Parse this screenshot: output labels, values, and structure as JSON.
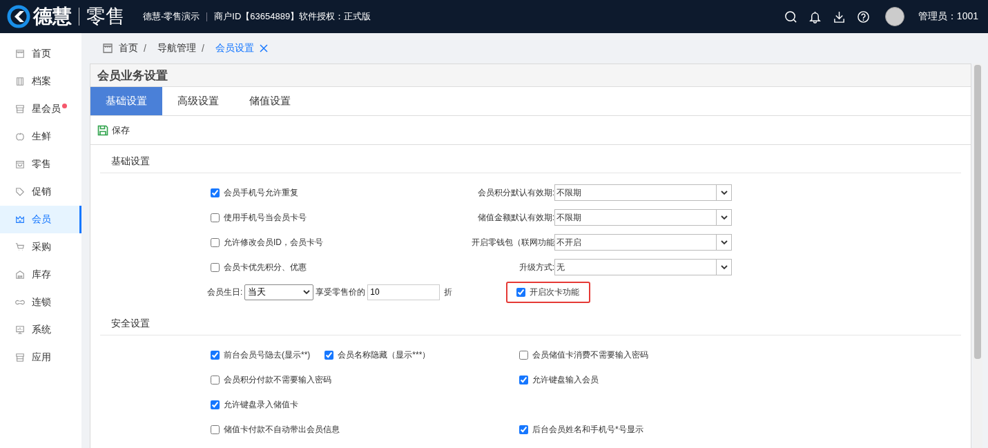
{
  "header": {
    "brand_name": "德慧",
    "brand_product": "零售",
    "store": "德慧-零售演示",
    "license": "商户ID【63654889】软件授权：正式版",
    "user": "管理员：1001"
  },
  "sidebar": {
    "items": [
      {
        "label": "首页",
        "selected": false,
        "badge": false
      },
      {
        "label": "档案",
        "selected": false,
        "badge": false
      },
      {
        "label": "星会员",
        "selected": false,
        "badge": true
      },
      {
        "label": "生鲜",
        "selected": false,
        "badge": false
      },
      {
        "label": "零售",
        "selected": false,
        "badge": false
      },
      {
        "label": "促销",
        "selected": false,
        "badge": false
      },
      {
        "label": "会员",
        "selected": true,
        "badge": false
      },
      {
        "label": "采购",
        "selected": false,
        "badge": false
      },
      {
        "label": "库存",
        "selected": false,
        "badge": false
      },
      {
        "label": "连锁",
        "selected": false,
        "badge": false
      },
      {
        "label": "系统",
        "selected": false,
        "badge": false
      },
      {
        "label": "应用",
        "selected": false,
        "badge": false
      }
    ]
  },
  "breadcrumb": {
    "separator": "/",
    "items": [
      {
        "label": "首页",
        "current": false
      },
      {
        "label": "导航管理",
        "current": false
      },
      {
        "label": "会员设置",
        "current": true
      }
    ]
  },
  "panel": {
    "title": "会员业务设置",
    "tabs": [
      {
        "label": "基础设置",
        "selected": true
      },
      {
        "label": "高级设置",
        "selected": false
      },
      {
        "label": "储值设置",
        "selected": false
      }
    ],
    "save_button": "保存",
    "basic": {
      "title": "基础设置",
      "left": [
        {
          "kind": "checkbox",
          "label": "会员手机号允许重复",
          "checked": true
        },
        {
          "kind": "checkbox",
          "label": "使用手机号当会员卡号",
          "checked": false
        },
        {
          "kind": "checkbox",
          "label": "允许修改会员ID，会员卡号",
          "checked": false
        },
        {
          "kind": "checkbox",
          "label": "会员卡优先积分、优惠",
          "checked": false
        },
        {
          "kind": "birthday",
          "label": "会员生日:",
          "select_value": "当天",
          "mid_label": "享受零售价的",
          "input_value": "10",
          "unit": "折"
        }
      ],
      "right": [
        {
          "kind": "select",
          "label": "会员积分默认有效期:",
          "value": "不限期"
        },
        {
          "kind": "select",
          "label": "储值金额默认有效期:",
          "value": "不限期"
        },
        {
          "kind": "select",
          "label": "开启零钱包（联网功能",
          "value": "不开启"
        },
        {
          "kind": "select",
          "label": "升级方式:",
          "value": "无"
        },
        {
          "kind": "checkbox",
          "label": "开启次卡功能",
          "checked": true,
          "highlighted": true
        }
      ]
    },
    "security": {
      "title": "安全设置",
      "rows": [
        {
          "left": [
            {
              "label": "前台会员号隐去(显示**)",
              "checked": true
            },
            {
              "label": "会员名称隐藏（显示***）",
              "checked": true
            }
          ],
          "right": [
            {
              "label": "会员储值卡消费不需要输入密码",
              "checked": false
            }
          ]
        },
        {
          "left": [
            {
              "label": "会员积分付款不需要输入密码",
              "checked": false
            }
          ],
          "right": [
            {
              "label": "允许键盘输入会员",
              "checked": true
            }
          ]
        },
        {
          "left": [
            {
              "label": "允许键盘录入储值卡",
              "checked": true
            }
          ],
          "right": []
        },
        {
          "left": [
            {
              "label": "储值卡付款不自动带出会员信息",
              "checked": false
            }
          ],
          "right": [
            {
              "label": "后台会员姓名和手机号*号显示",
              "checked": true
            }
          ]
        }
      ]
    }
  }
}
